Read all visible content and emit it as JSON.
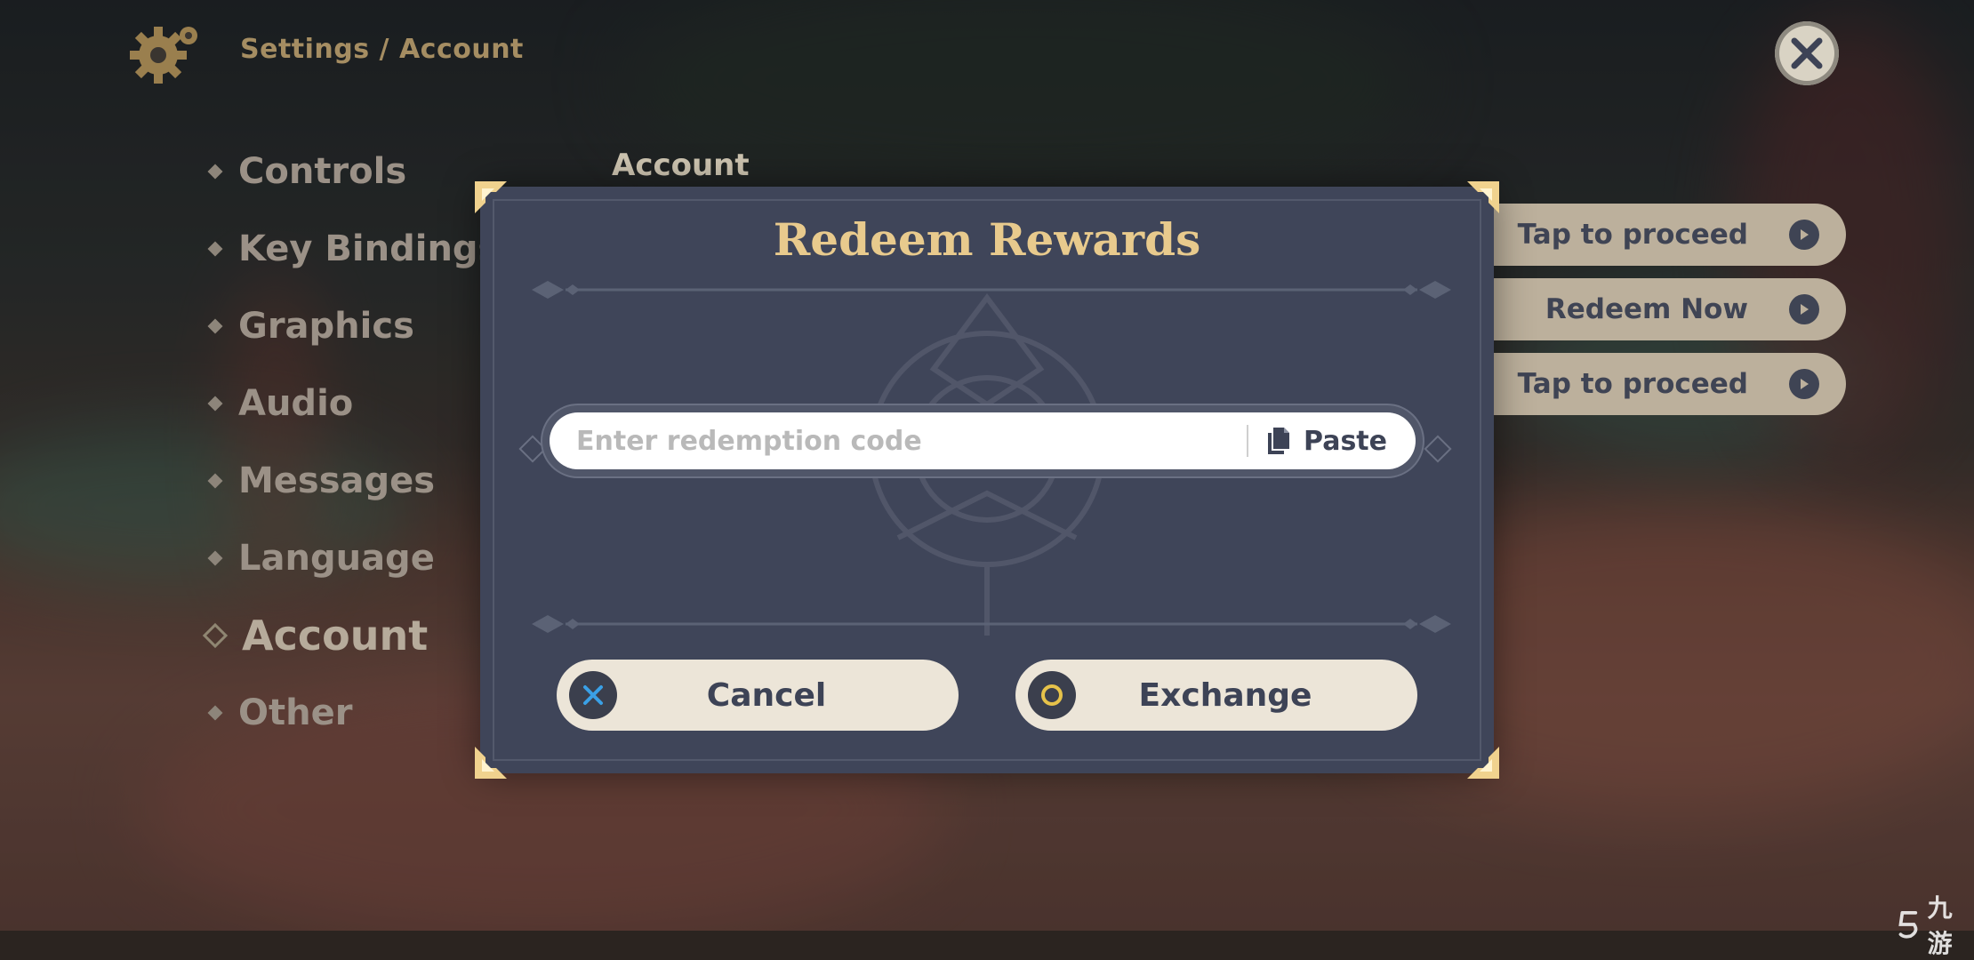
{
  "header": {
    "breadcrumb": "Settings / Account",
    "settings_icon": "gear-icon",
    "close_icon": "close-icon"
  },
  "menu": {
    "items": [
      {
        "label": "Controls"
      },
      {
        "label": "Key Bindings"
      },
      {
        "label": "Graphics"
      },
      {
        "label": "Audio"
      },
      {
        "label": "Messages"
      },
      {
        "label": "Language"
      },
      {
        "label": "Account",
        "active": true
      },
      {
        "label": "Other"
      }
    ]
  },
  "section": {
    "title": "Account"
  },
  "account_actions": [
    {
      "label": "Tap to proceed"
    },
    {
      "label": "Redeem Now"
    },
    {
      "label": "Tap to proceed"
    }
  ],
  "dialog": {
    "title": "Redeem Rewards",
    "code_input": {
      "placeholder": "Enter redemption code",
      "value": ""
    },
    "paste_label": "Paste",
    "cancel_label": "Cancel",
    "exchange_label": "Exchange"
  },
  "watermark": {
    "text": "九游"
  },
  "colors": {
    "accent_gold": "#e8ca8d",
    "dialog_bg": "#3f4559",
    "button_bg": "#ece5d8",
    "cancel_icon": "#3aa0e6",
    "exchange_icon": "#e6c24a"
  }
}
